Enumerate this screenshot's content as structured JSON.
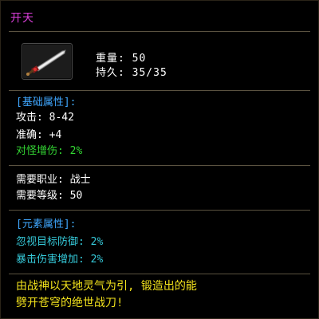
{
  "colors": {
    "title": "#d83ed8",
    "section_header": "#3fa7ff",
    "white": "#ffffff",
    "green_bonus": "#33d633",
    "element_stat": "#35c8d8",
    "description": "#f2e21c",
    "divider": "#5a5240"
  },
  "item": {
    "name": "开天",
    "icon": "greatsword-icon",
    "weight": "重量: 50",
    "durability": "持久: 35/35"
  },
  "base_attributes": {
    "header": "[基础属性]:",
    "attack": "攻击: 8-42",
    "accuracy": "准确: +4",
    "bonus": "对怪增伤: 2%"
  },
  "requirements": {
    "class": "需要职业: 战士",
    "level": "需要等级: 50"
  },
  "element_attributes": {
    "header": "[元素属性]:",
    "ignore_defense": "忽视目标防御: 2%",
    "crit_damage": "暴击伤害增加: 2%"
  },
  "description": {
    "line1": "由战神以天地灵气为引, 锻造出的能",
    "line2": "劈开苍穹的绝世战刀!"
  }
}
